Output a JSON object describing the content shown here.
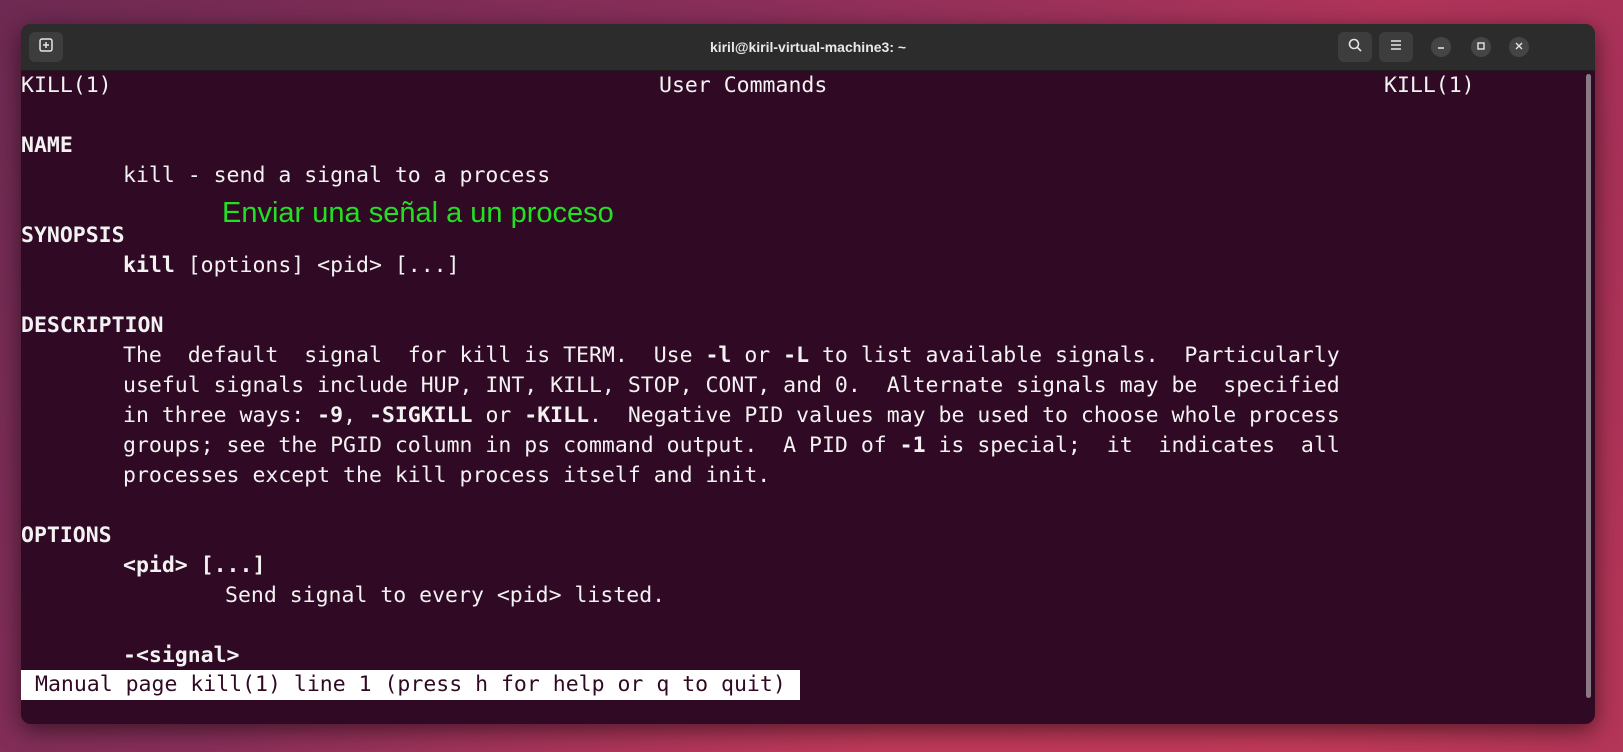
{
  "window": {
    "title": "kiril@kiril-virtual-machine3: ~"
  },
  "header": {
    "left": "KILL(1)",
    "center": "User Commands",
    "right": "KILL(1)"
  },
  "sections": {
    "name_heading": "NAME",
    "name_text": "kill - send a signal to a process",
    "synopsis_heading": "SYNOPSIS",
    "synopsis_cmd": "kill",
    "synopsis_args": " [options] <pid> [...]",
    "description_heading": "DESCRIPTION",
    "description": [
      {
        "segments": [
          "The  default  signal  for kill is TERM.  Use ",
          "-l",
          " or ",
          "-L",
          " to list available signals.  Particularly"
        ]
      },
      {
        "segments": [
          "useful signals include HUP, INT, KILL, STOP, CONT, and 0.  Alternate signals may be  specified"
        ]
      },
      {
        "segments": [
          "in three ways: ",
          "-9",
          ", ",
          "-SIGKILL",
          " or ",
          "-KILL",
          ".  Negative PID values may be used to choose whole process"
        ]
      },
      {
        "segments": [
          "groups; see the PGID column in ps command output.  A PID of ",
          "-1",
          " is special;  it  indicates  all"
        ]
      },
      {
        "segments": [
          "processes except the kill process itself and init."
        ]
      }
    ],
    "options_heading": "OPTIONS",
    "option1": "<pid> [...]",
    "option1_desc": "Send signal to every <pid> listed.",
    "option2": "-<signal>"
  },
  "status": "Manual page kill(1) line 1 (press h for help or q to quit)",
  "overlay_caption": "Enviar una señal a un proceso",
  "icons": {
    "new_tab": "new-tab-icon",
    "search": "search-icon",
    "menu": "hamburger-menu-icon",
    "minimize": "minimize-icon",
    "maximize": "maximize-icon",
    "close": "close-icon"
  },
  "colors": {
    "terminal_bg": "#300a24",
    "terminal_fg": "#f2f2f2",
    "overlay": "#22e022"
  }
}
